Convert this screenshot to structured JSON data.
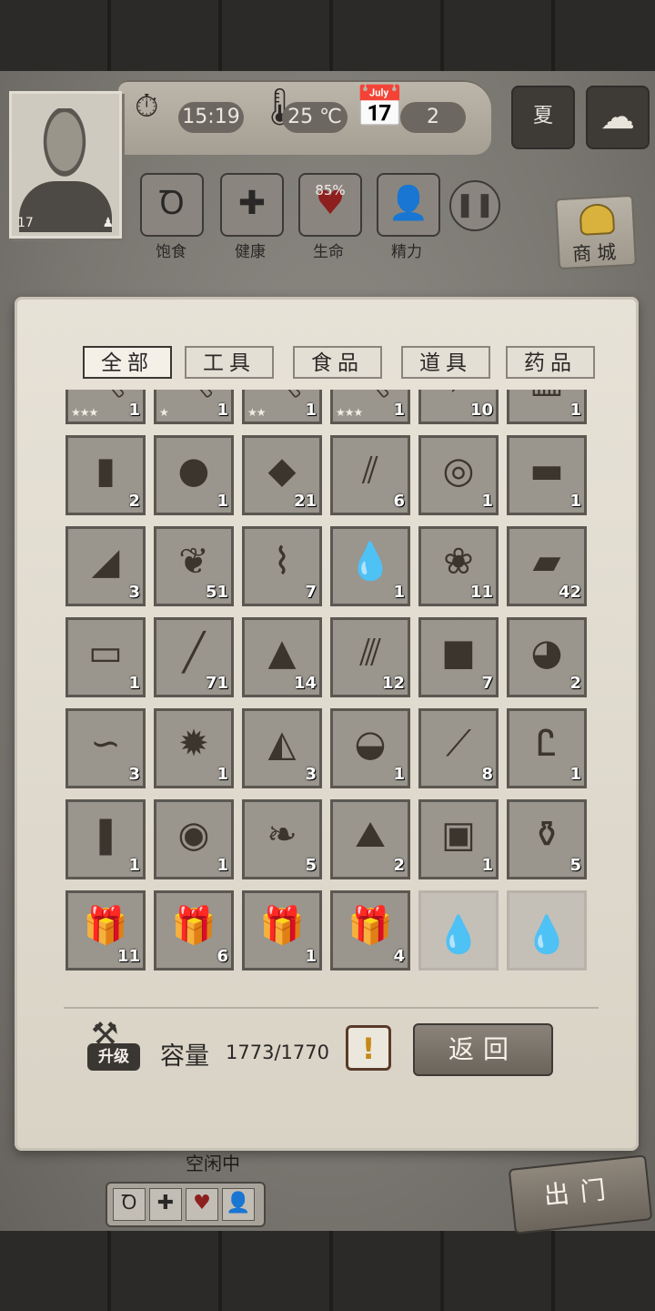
{
  "hud": {
    "time": "15:19",
    "temperature": "25 ℃",
    "day": "2",
    "season": "夏",
    "level": "17"
  },
  "stats": [
    {
      "label": "饱食",
      "icon": "stomach-icon"
    },
    {
      "label": "健康",
      "icon": "cross-icon"
    },
    {
      "label": "生命",
      "icon": "heart-icon",
      "value": "85%"
    },
    {
      "label": "精力",
      "icon": "person-icon"
    }
  ],
  "shop": {
    "label": "商城"
  },
  "tabs": [
    {
      "label": "全部",
      "active": true
    },
    {
      "label": "工具",
      "active": false
    },
    {
      "label": "食品",
      "active": false
    },
    {
      "label": "道具",
      "active": false
    },
    {
      "label": "药品",
      "active": false
    }
  ],
  "items": [
    {
      "icon": "pickaxe-icon",
      "glyph": "⛏",
      "count": "1",
      "stars": "★★★"
    },
    {
      "icon": "pickaxe-icon",
      "glyph": "⛏",
      "count": "1",
      "stars": "★"
    },
    {
      "icon": "pickaxe-icon",
      "glyph": "⛏",
      "count": "1",
      "stars": "★★"
    },
    {
      "icon": "pickaxe-icon",
      "glyph": "⛏",
      "count": "1",
      "stars": "★★★"
    },
    {
      "icon": "arrows-icon",
      "glyph": "➶",
      "count": "10",
      "stars": ""
    },
    {
      "icon": "armor-icon",
      "glyph": "▥",
      "count": "1",
      "stars": ""
    },
    {
      "icon": "logs-icon",
      "glyph": "▮",
      "count": "2",
      "stars": ""
    },
    {
      "icon": "wood-ball-icon",
      "glyph": "●",
      "count": "1",
      "stars": ""
    },
    {
      "icon": "stone-icon",
      "glyph": "◆",
      "count": "21",
      "stars": ""
    },
    {
      "icon": "bamboo-icon",
      "glyph": "⫽",
      "count": "6",
      "stars": ""
    },
    {
      "icon": "rope-icon",
      "glyph": "◎",
      "count": "1",
      "stars": ""
    },
    {
      "icon": "planks-icon",
      "glyph": "▬",
      "count": "1",
      "stars": ""
    },
    {
      "icon": "flint-icon",
      "glyph": "◢",
      "count": "3",
      "stars": ""
    },
    {
      "icon": "leaf-icon",
      "glyph": "❦",
      "count": "51",
      "stars": ""
    },
    {
      "icon": "resin-branch-icon",
      "glyph": "⌇",
      "count": "7",
      "stars": ""
    },
    {
      "icon": "water-puddle-icon",
      "glyph": "💧",
      "count": "1",
      "stars": ""
    },
    {
      "icon": "wheat-icon",
      "glyph": "❀",
      "count": "11",
      "stars": ""
    },
    {
      "icon": "wood-board-icon",
      "glyph": "▰",
      "count": "42",
      "stars": ""
    },
    {
      "icon": "slab-icon",
      "glyph": "▭",
      "count": "1",
      "stars": ""
    },
    {
      "icon": "nail-icon",
      "glyph": "╱",
      "count": "71",
      "stars": ""
    },
    {
      "icon": "soil-icon",
      "glyph": "▲",
      "count": "14",
      "stars": ""
    },
    {
      "icon": "sticks-icon",
      "glyph": "⫻",
      "count": "12",
      "stars": ""
    },
    {
      "icon": "charcoal-icon",
      "glyph": "■",
      "count": "7",
      "stars": ""
    },
    {
      "icon": "ore-icon",
      "glyph": "◕",
      "count": "2",
      "stars": ""
    },
    {
      "icon": "worm-icon",
      "glyph": "∽",
      "count": "3",
      "stars": ""
    },
    {
      "icon": "mud-icon",
      "glyph": "✹",
      "count": "1",
      "stars": ""
    },
    {
      "icon": "rocks-icon",
      "glyph": "◭",
      "count": "3",
      "stars": ""
    },
    {
      "icon": "bread-icon",
      "glyph": "◒",
      "count": "1",
      "stars": ""
    },
    {
      "icon": "thorns-icon",
      "glyph": "⟋",
      "count": "8",
      "stars": ""
    },
    {
      "icon": "horns-icon",
      "glyph": "Ꮭ",
      "count": "1",
      "stars": ""
    },
    {
      "icon": "bark-icon",
      "glyph": "❚",
      "count": "1",
      "stars": ""
    },
    {
      "icon": "grain-bowl-icon",
      "glyph": "◉",
      "count": "1",
      "stars": ""
    },
    {
      "icon": "shrimp-icon",
      "glyph": "❧",
      "count": "5",
      "stars": ""
    },
    {
      "icon": "salt-icon",
      "glyph": "⛰",
      "count": "2",
      "stars": ""
    },
    {
      "icon": "backpack-icon",
      "glyph": "▣",
      "count": "1",
      "stars": ""
    },
    {
      "icon": "bottle-icon",
      "glyph": "⚱",
      "count": "5",
      "stars": ""
    },
    {
      "icon": "gift-box-food-icon",
      "glyph": "🎁",
      "count": "11",
      "stars": ""
    },
    {
      "icon": "gift-box-medical-icon",
      "glyph": "🎁",
      "count": "6",
      "stars": ""
    },
    {
      "icon": "gift-box-tools-icon",
      "glyph": "🎁",
      "count": "1",
      "stars": ""
    },
    {
      "icon": "gift-box-wood-icon",
      "glyph": "🎁",
      "count": "4",
      "stars": ""
    },
    {
      "icon": "empty-slot-icon",
      "glyph": "",
      "count": "",
      "stars": "",
      "empty": true
    },
    {
      "icon": "empty-slot-icon",
      "glyph": "",
      "count": "",
      "stars": "",
      "empty": true
    }
  ],
  "footer": {
    "upgrade_label": "升级",
    "capacity_label": "容量",
    "capacity_value": "1773/1770",
    "warning": "!",
    "back_label": "返回"
  },
  "scene": {
    "status": "空闲中",
    "exit_label": "出门"
  }
}
